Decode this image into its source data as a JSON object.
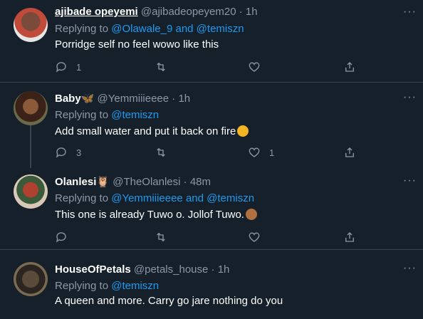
{
  "tweets": [
    {
      "name": "ajibade opeyemi",
      "handle": "@ajibadeopeyem20",
      "sep": "·",
      "time": "1h",
      "replying_prefix": "Replying to ",
      "replying_targets": "@Olawale_9 and @temiszn",
      "text": "Porridge self no feel wowo like this",
      "reply_count": "1",
      "retweet_count": "",
      "like_count": "",
      "avatar_color": "#a23a3a"
    },
    {
      "name": "Baby",
      "name_emoji": "blue-butterfly-icon",
      "handle": "@Yemmiiieeee",
      "sep": "·",
      "time": "1h",
      "replying_prefix": "Replying to ",
      "replying_targets": "@temiszn",
      "text": "Add small water and put it back on fire",
      "text_emoji": "face-with-hand-over-mouth-icon",
      "reply_count": "3",
      "retweet_count": "",
      "like_count": "1",
      "avatar_color": "#5a3b2a"
    },
    {
      "name": "Olanlesi",
      "name_emoji": "owl-icon",
      "handle": "@TheOlanlesi",
      "sep": "·",
      "time": "48m",
      "replying_prefix": "Replying to ",
      "replying_targets": "@Yemmiiieeee and @temiszn",
      "text": "This one is already Tuwo o. Jollof Tuwo.",
      "text_emoji": "see-no-evil-monkey-icon",
      "reply_count": "",
      "retweet_count": "",
      "like_count": "",
      "avatar_color": "#6b3b3b"
    },
    {
      "name": "HouseOfPetals",
      "handle": "@petals_house",
      "sep": "·",
      "time": "1h",
      "replying_prefix": "Replying to ",
      "replying_targets": "@temiszn",
      "text": "A queen and more. Carry go jare nothing do you",
      "avatar_color": "#4b4030"
    }
  ],
  "colors": {
    "background": "#15202b",
    "divider": "#38444d",
    "secondary_text": "#8b98a5",
    "link": "#1d9bf0"
  }
}
